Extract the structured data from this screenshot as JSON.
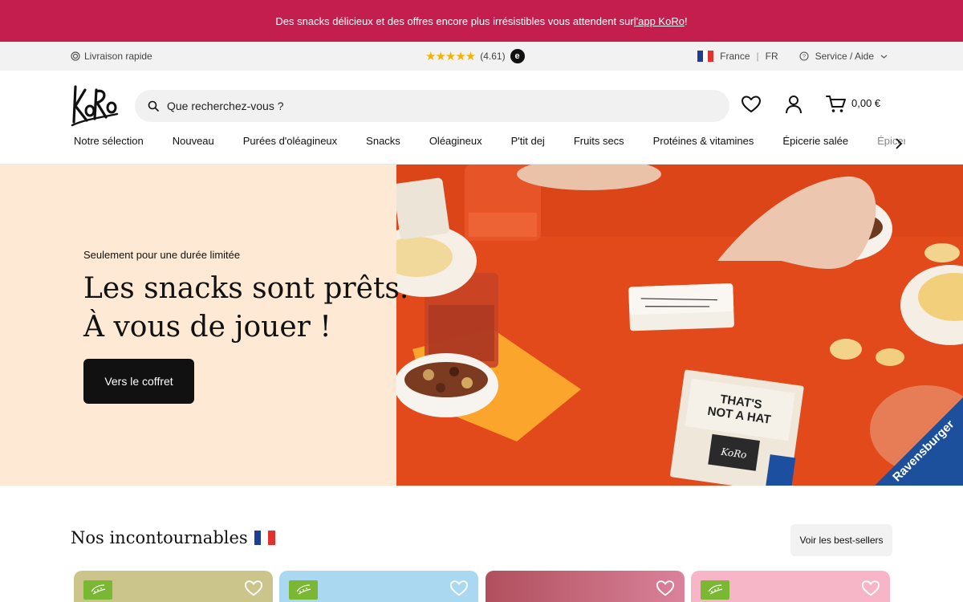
{
  "promo": {
    "text": "Des snacks délicieux et des offres encore plus irrésistibles vous attendent sur ",
    "link": "l'app KoRo",
    "suffix": " !"
  },
  "utility": {
    "delivery": "Livraison rapide",
    "rating": "(4.61)",
    "trusted_badge": "e",
    "country": "France",
    "language": "FR",
    "service": "Service / Aide"
  },
  "header": {
    "logo_text": "KoRo",
    "search_placeholder": "Que recherchez-vous ?",
    "cart_total": "0,00 €"
  },
  "nav": {
    "items": [
      "Notre sélection",
      "Nouveau",
      "Purées d'oléagineux",
      "Snacks",
      "Oléagineux",
      "P'tit dej",
      "Fruits secs",
      "Protéines & vitamines",
      "Épicerie salée",
      "Épicerie sucrée"
    ]
  },
  "hero": {
    "kicker": "Seulement pour une durée limitée",
    "title_line1": "Les snacks sont prêts.",
    "title_line2": "À vous de jouer !",
    "button": "Vers le coffret",
    "image": {
      "ribbon": "Ravensburger",
      "box_title_1": "THAT'S",
      "box_title_2": "NOT A HAT",
      "box_brand": "KoRo"
    }
  },
  "bestsellers": {
    "title": "Nos incontournables",
    "button": "Voir les best-sellers",
    "cards": [
      {
        "color": "#cbc58b"
      },
      {
        "color": "#a9d8f0"
      },
      {
        "color": "#b65a66"
      },
      {
        "color": "#f7b6c8"
      }
    ]
  },
  "colors": {
    "promo_bg": "#c41e4f",
    "hero_left_bg": "#fde9d4",
    "hero_right_bg": "#e14a1c",
    "button_dark": "#111111",
    "bio_green": "#7ab733"
  }
}
